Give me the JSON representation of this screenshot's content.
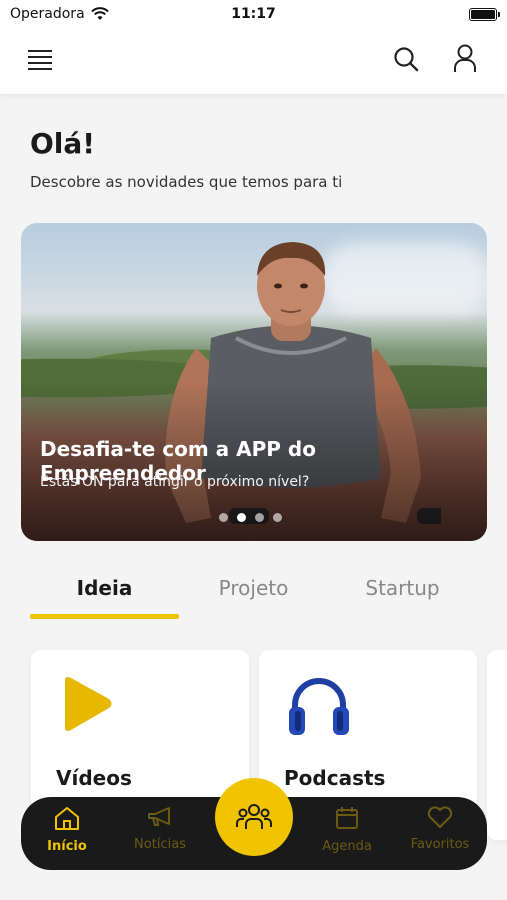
{
  "status_bar": {
    "carrier": "Operadora",
    "time": "11:17"
  },
  "header": {
    "menu_icon": "menu-icon",
    "search_icon": "search-icon",
    "user_icon": "user-icon"
  },
  "greeting": {
    "title": "Olá!",
    "subtitle": "Descobre as novidades que temos para ti"
  },
  "banner": {
    "title": "Desafia-te com a APP do Empreendedor",
    "subtitle": "Estás ON para atingir o próximo nível?",
    "slide_count": 4,
    "active_slide": 2
  },
  "tabs": [
    {
      "label": "Ideia",
      "active": true
    },
    {
      "label": "Projeto",
      "active": false
    },
    {
      "label": "Startup",
      "active": false
    }
  ],
  "cards": [
    {
      "title": "Vídeos",
      "icon": "play-icon"
    },
    {
      "title": "Podcasts",
      "icon": "headphones-icon"
    }
  ],
  "bottom_nav": {
    "items": [
      {
        "label": "Início",
        "icon": "home-icon",
        "active": true
      },
      {
        "label": "Notícias",
        "icon": "megaphone-icon",
        "active": false
      },
      {
        "label": "Agenda",
        "icon": "calendar-icon",
        "active": false
      },
      {
        "label": "Favoritos",
        "icon": "heart-icon",
        "active": false
      }
    ],
    "center_icon": "community-icon"
  },
  "colors": {
    "accent": "#f0c400",
    "nav_background": "#1a1a1a",
    "page_background": "#f4f4f4"
  }
}
